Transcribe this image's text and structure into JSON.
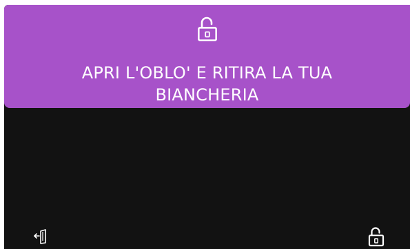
{
  "banner": {
    "icon": "unlock-icon",
    "message": "APRI L'OBLO' E RITIRA LA TUA BIANCHERIA",
    "color": "#a752c9"
  },
  "screen": {
    "background": "#121212"
  },
  "footer": {
    "left_icon": "exit-door-icon",
    "right_icon": "unlock-icon"
  }
}
